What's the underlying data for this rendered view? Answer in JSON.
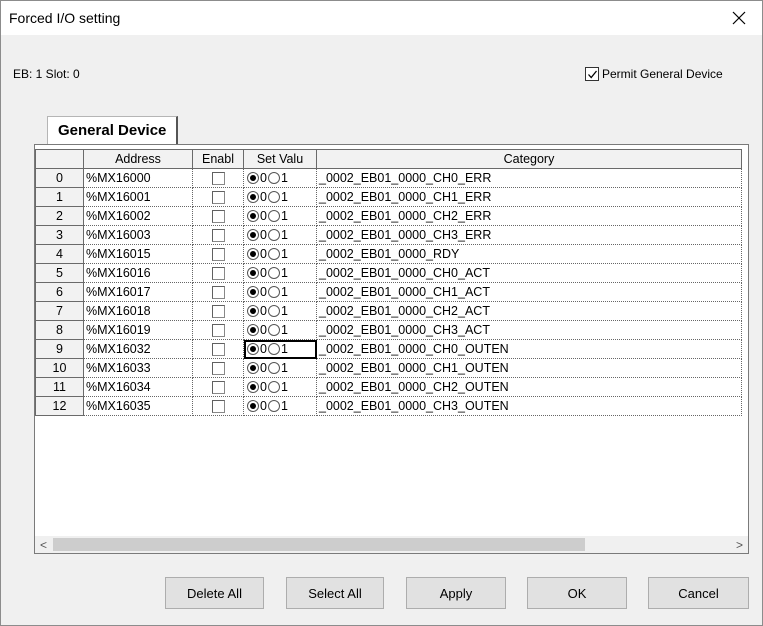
{
  "window": {
    "title": "Forced I/O setting"
  },
  "info": {
    "slot_text": "EB: 1 Slot: 0"
  },
  "permit": {
    "label": "Permit General Device",
    "checked": true
  },
  "tab": {
    "label": "General Device"
  },
  "grid": {
    "headers": {
      "row": "",
      "address": "Address",
      "enable": "Enabl",
      "set_value": "Set Valu",
      "category": "Category"
    },
    "radio_label_0": "0",
    "radio_label_1": "1",
    "rows": [
      {
        "num": "0",
        "address": "%MX16000",
        "enabled": false,
        "value": 0,
        "category": "_0002_EB01_0000_CH0_ERR"
      },
      {
        "num": "1",
        "address": "%MX16001",
        "enabled": false,
        "value": 0,
        "category": "_0002_EB01_0000_CH1_ERR"
      },
      {
        "num": "2",
        "address": "%MX16002",
        "enabled": false,
        "value": 0,
        "category": "_0002_EB01_0000_CH2_ERR"
      },
      {
        "num": "3",
        "address": "%MX16003",
        "enabled": false,
        "value": 0,
        "category": "_0002_EB01_0000_CH3_ERR"
      },
      {
        "num": "4",
        "address": "%MX16015",
        "enabled": false,
        "value": 0,
        "category": "_0002_EB01_0000_RDY"
      },
      {
        "num": "5",
        "address": "%MX16016",
        "enabled": false,
        "value": 0,
        "category": "_0002_EB01_0000_CH0_ACT"
      },
      {
        "num": "6",
        "address": "%MX16017",
        "enabled": false,
        "value": 0,
        "category": "_0002_EB01_0000_CH1_ACT"
      },
      {
        "num": "7",
        "address": "%MX16018",
        "enabled": false,
        "value": 0,
        "category": "_0002_EB01_0000_CH2_ACT"
      },
      {
        "num": "8",
        "address": "%MX16019",
        "enabled": false,
        "value": 0,
        "category": "_0002_EB01_0000_CH3_ACT"
      },
      {
        "num": "9",
        "address": "%MX16032",
        "enabled": false,
        "value": 0,
        "category": "_0002_EB01_0000_CH0_OUTEN"
      },
      {
        "num": "10",
        "address": "%MX16033",
        "enabled": false,
        "value": 0,
        "category": "_0002_EB01_0000_CH1_OUTEN"
      },
      {
        "num": "11",
        "address": "%MX16034",
        "enabled": false,
        "value": 0,
        "category": "_0002_EB01_0000_CH2_OUTEN"
      },
      {
        "num": "12",
        "address": "%MX16035",
        "enabled": false,
        "value": 0,
        "category": "_0002_EB01_0000_CH3_OUTEN"
      }
    ]
  },
  "scrollbar": {
    "left_arrow": "<",
    "right_arrow": ">"
  },
  "buttons": {
    "delete_all": "Delete All",
    "select_all": "Select All",
    "apply": "Apply",
    "ok": "OK",
    "cancel": "Cancel"
  },
  "icons": {
    "close": "close-icon",
    "check": "check-icon"
  }
}
